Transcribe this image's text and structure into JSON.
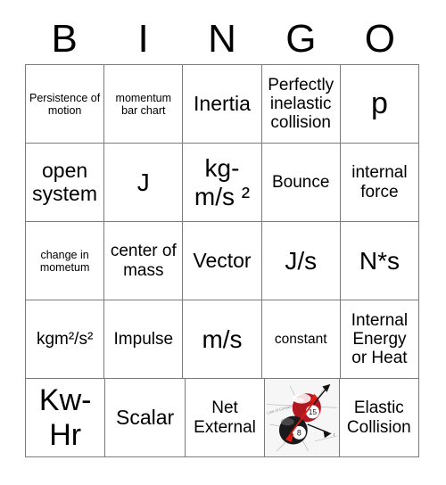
{
  "header": {
    "letters": [
      "B",
      "I",
      "N",
      "G",
      "O"
    ]
  },
  "grid": {
    "rows": [
      [
        {
          "text": "Persistence of motion",
          "size": "fs-xs"
        },
        {
          "text": "momentum bar chart",
          "size": "fs-xs"
        },
        {
          "text": "Inertia",
          "size": "fs-lg"
        },
        {
          "text": "Perfectly inelastic collision",
          "size": "fs-md"
        },
        {
          "text": "p",
          "size": "fs-xxl"
        }
      ],
      [
        {
          "text": "open system",
          "size": "fs-lg"
        },
        {
          "text": "J",
          "size": "fs-xl"
        },
        {
          "text": "kg-\nm/s ²",
          "size": "fs-xl"
        },
        {
          "text": "Bounce",
          "size": "fs-md"
        },
        {
          "text": "internal force",
          "size": "fs-md"
        }
      ],
      [
        {
          "text": "change in mometum",
          "size": "fs-xs"
        },
        {
          "text": "center of mass",
          "size": "fs-md"
        },
        {
          "text": "Vector",
          "size": "fs-lg"
        },
        {
          "text": "J/s",
          "size": "fs-xl"
        },
        {
          "text": "N*s",
          "size": "fs-xl"
        }
      ],
      [
        {
          "text": "kgm²/s²",
          "size": "fs-md"
        },
        {
          "text": "Impulse",
          "size": "fs-md"
        },
        {
          "text": "m/s",
          "size": "fs-xl"
        },
        {
          "text": "constant",
          "size": "fs-sm"
        },
        {
          "text": "Internal Energy or Heat",
          "size": "fs-md"
        }
      ],
      [
        {
          "text": "Kw-\nHr",
          "size": "fs-xxl"
        },
        {
          "text": "Scalar",
          "size": "fs-lg"
        },
        {
          "text": "Net External",
          "size": "fs-md"
        },
        {
          "image": "billiard-ball-collision-diagram"
        },
        {
          "text": "Elastic Collision",
          "size": "fs-md"
        }
      ]
    ]
  },
  "image_cell": {
    "ball_red_number": "15",
    "ball_black_number": "8",
    "annotation_line": "Line of Contact",
    "colors": {
      "red_ball": "#b01721",
      "black_ball": "#1a1a1a",
      "vector_red": "#e01b12",
      "vector_black": "#111111",
      "background": "#f6f6f6"
    }
  }
}
